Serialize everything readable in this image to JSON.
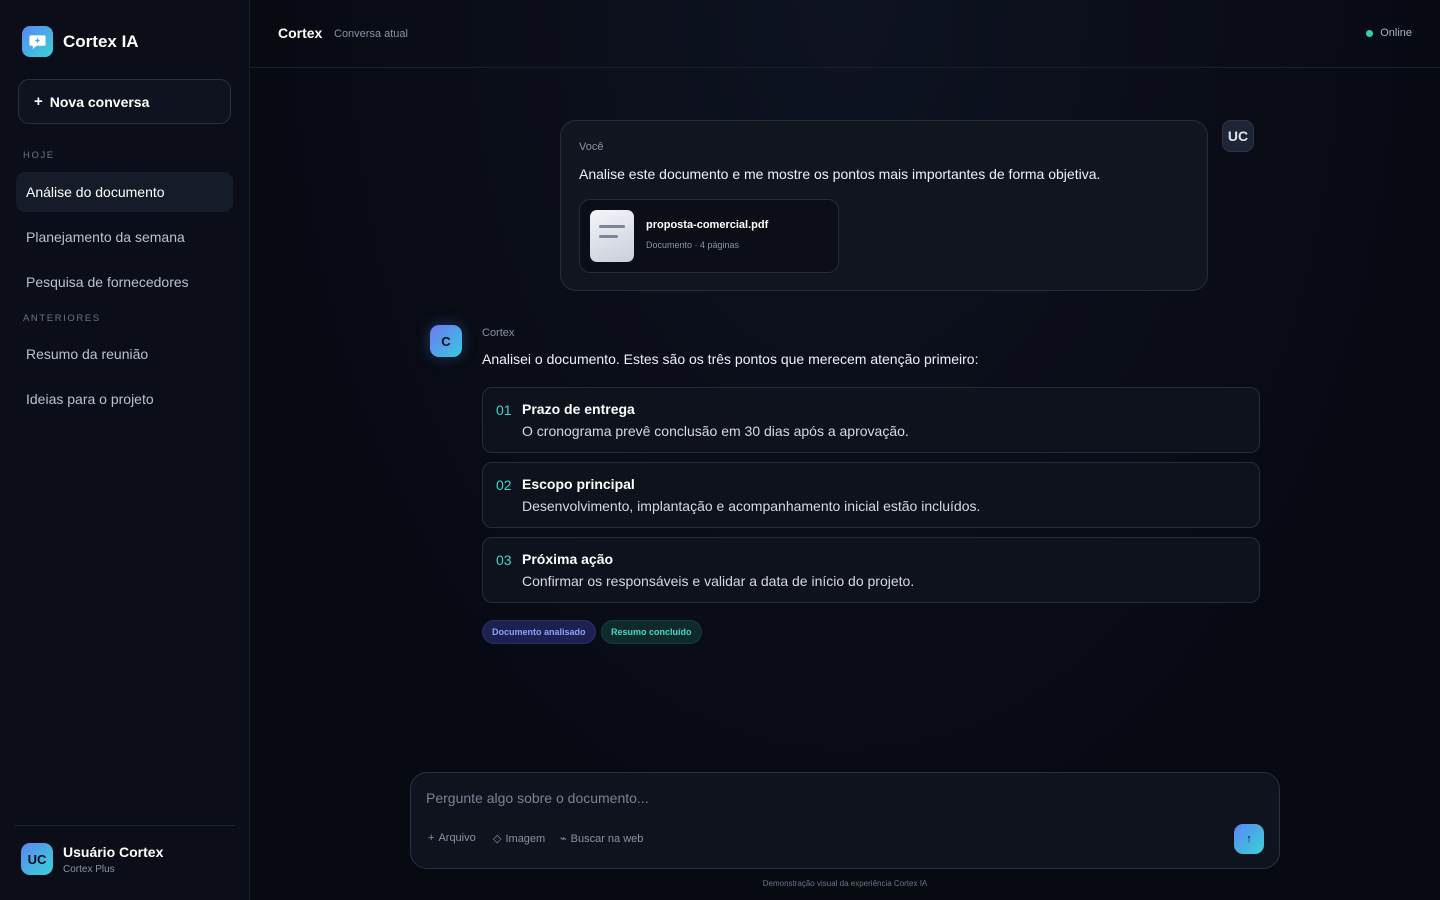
{
  "sidebar": {
    "brand": "Cortex IA",
    "new_chat_label": "Nova conversa",
    "section_today": "HOJE",
    "section_previous": "ANTERIORES",
    "today_items": [
      {
        "label": "Análise do documento"
      },
      {
        "label": "Planejamento da semana"
      },
      {
        "label": "Pesquisa de fornecedores"
      }
    ],
    "previous_items": [
      {
        "label": "Resumo da reunião"
      },
      {
        "label": "Ideias para o projeto"
      }
    ],
    "user": {
      "initials": "UC",
      "name": "Usuário Cortex",
      "plan": "Cortex Plus"
    }
  },
  "header": {
    "title": "Cortex",
    "subtitle": "Conversa atual",
    "status": "Online"
  },
  "user_message": {
    "author": "Você",
    "text": "Analise este documento e me mostre os pontos mais importantes de forma objetiva.",
    "avatar": "UC",
    "attachment": {
      "name": "proposta-comercial.pdf",
      "meta": "Documento · 4 páginas"
    }
  },
  "assistant_message": {
    "avatar": "C",
    "author": "Cortex",
    "intro": "Analisei o documento. Estes são os três pontos que merecem atenção primeiro:",
    "points": [
      {
        "num": "01",
        "title": "Prazo de entrega",
        "desc": "O cronograma prevê conclusão em 30 dias após a aprovação."
      },
      {
        "num": "02",
        "title": "Escopo principal",
        "desc": "Desenvolvimento, implantação e acompanhamento inicial estão incluídos."
      },
      {
        "num": "03",
        "title": "Próxima ação",
        "desc": "Confirmar os responsáveis e validar a data de início do projeto."
      }
    ],
    "tags": [
      "Documento analisado",
      "Resumo concluído"
    ]
  },
  "composer": {
    "placeholder": "Pergunte algo sobre o documento...",
    "tools": [
      {
        "icon": "+",
        "label": "Arquivo"
      },
      {
        "icon": "◇",
        "label": "Imagem"
      },
      {
        "icon": "⌁",
        "label": "Buscar na web"
      }
    ],
    "send_icon": "↑"
  },
  "footer": "Demonstração visual da experiência Cortex IA",
  "colors": {
    "accent": "#3fd6c4",
    "status_online": "#2ed3a8",
    "brand_gradient_start": "#5a86f4",
    "brand_gradient_end": "#39d3d6"
  }
}
